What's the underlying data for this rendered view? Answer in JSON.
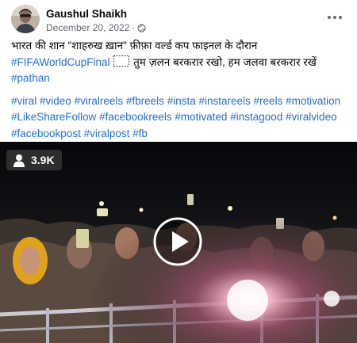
{
  "post": {
    "author": "Gaushul Shaikh",
    "date": "December 20, 2022",
    "audience_icon": "globe-icon",
    "caption": {
      "line1": "भारत की शान \"शाहरुख ख़ान\" फ़ीफ़ा वर्ल्ड कप फाइनल के दौरान",
      "line2_tag": "#FIFAWorldCupFinal",
      "line2_text": "तुम ज़लन बरकरार रखो, हम जलवा बरकरार रखें",
      "line3_tag": "#pathan"
    },
    "hashtags": {
      "row1": [
        "#viral",
        "#video",
        "#viralreels",
        "#fbreels",
        "#insta",
        "#instareels",
        "#reels",
        "#motivation"
      ],
      "row2": [
        "#LikeShareFollow",
        "#facebookreels",
        "#motivated",
        "#instagood",
        "#viralvideo"
      ],
      "row3": [
        "#facebookpost",
        "#viralpost",
        "#fb"
      ]
    },
    "link_color": "#216fdb"
  },
  "video": {
    "views": "3.9K",
    "views_icon": "person-icon",
    "play_icon": "play-icon"
  }
}
